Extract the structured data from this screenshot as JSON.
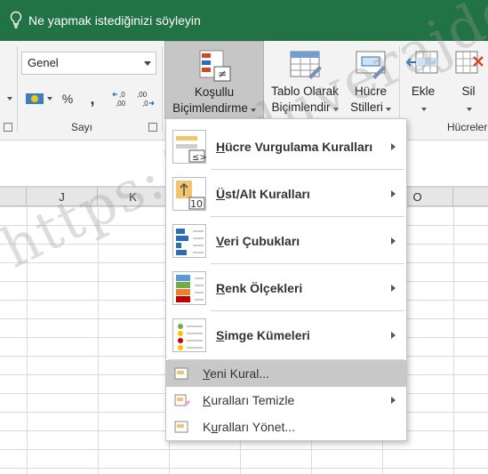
{
  "tell_me": {
    "text": "Ne yapmak istediğinizi söyleyin",
    "icon": "lightbulb-icon"
  },
  "ribbon": {
    "number_format": {
      "value": "Genel"
    },
    "number_group": {
      "label": "Sayı",
      "percent": "%",
      "comma": ",",
      "inc_decimal": "←,0 ,00",
      "dec_decimal": ",00 →,0"
    },
    "styles": {
      "conditional_formatting": {
        "line1": "Koşullu",
        "line2": "Biçimlendirme"
      },
      "format_as_table": {
        "line1": "Tablo Olarak",
        "line2": "Biçimlendir"
      },
      "cell_styles": {
        "line1": "Hücre",
        "line2": "Stilleri"
      }
    },
    "cells": {
      "insert": "Ekle",
      "delete": "Sil",
      "group_label": "Hücreler"
    }
  },
  "columns": [
    "J",
    "K",
    "O"
  ],
  "menu": {
    "items": [
      {
        "label_u": "H",
        "label_rest": "ücre Vurgulama Kuralları",
        "icon": "highlight-cells-icon",
        "submenu": true
      },
      {
        "label_u": "Ü",
        "label_rest": "st/Alt Kuralları",
        "icon": "top-bottom-icon",
        "submenu": true
      },
      {
        "label_u": "V",
        "label_rest": "eri Çubukları",
        "icon": "data-bars-icon",
        "submenu": true
      },
      {
        "label_u": "R",
        "label_rest": "enk Ölçekleri",
        "icon": "color-scales-icon",
        "submenu": true
      },
      {
        "label_u": "S",
        "label_rest": "imge Kümeleri",
        "icon": "icon-sets-icon",
        "submenu": true
      }
    ],
    "new_rule": {
      "label_u": "Y",
      "label_rest": "eni Kural..."
    },
    "clear_rules": {
      "label_u": "K",
      "label_rest": "uralları Temizle"
    },
    "manage_rules": {
      "label_pre": "K",
      "label_u": "u",
      "label_rest": "ralları Yönet..."
    }
  },
  "watermark": "https://diduverajder.com/",
  "colors": {
    "accent": "#217346",
    "menu_hover": "#c8c8c8",
    "ribbon_bg": "#f3f3f3"
  }
}
